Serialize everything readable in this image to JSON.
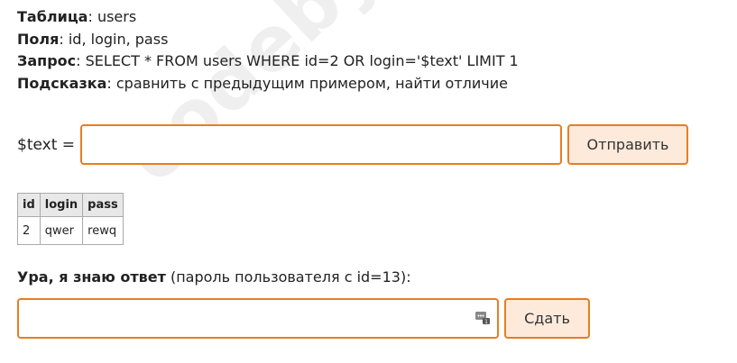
{
  "watermark": "codeby.net",
  "info": {
    "table_label": "Таблица",
    "table_value": ": users",
    "fields_label": "Поля",
    "fields_value": ": id, login, pass",
    "query_label": "Запрос",
    "query_value": ": SELECT * FROM users WHERE id=2 OR login='$text' LIMIT 1",
    "hint_label": "Подсказка",
    "hint_value": ": сравнить с предыдущим примером, найти отличие"
  },
  "query_form": {
    "label": "$text =",
    "value": "",
    "submit_label": "Отправить"
  },
  "result_table": {
    "headers": [
      "id",
      "login",
      "pass"
    ],
    "rows": [
      [
        "2",
        "qwer",
        "rewq"
      ]
    ]
  },
  "answer_form": {
    "bold_text": "Ура, я знаю ответ",
    "rest_text": " (пароль пользователя с id=13):",
    "value": "",
    "icon": "password-manager-icon",
    "submit_label": "Сдать"
  }
}
